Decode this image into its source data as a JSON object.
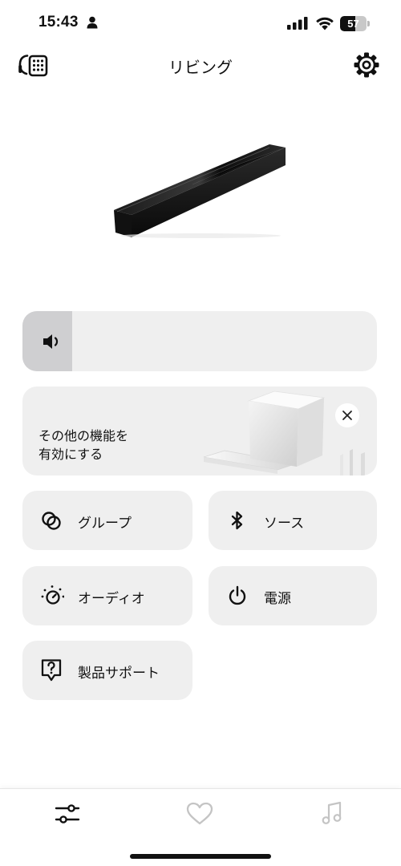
{
  "status_bar": {
    "time": "15:43",
    "battery_percent": "57",
    "battery_level": 0.57,
    "icons": [
      "person-icon",
      "cellular-signal-icon",
      "wifi-icon",
      "battery-icon"
    ]
  },
  "header": {
    "title": "リビング",
    "left_icon": "remote-control-icon",
    "right_icon": "gear-icon"
  },
  "volume": {
    "icon": "speaker-volume-icon",
    "level": 0.14
  },
  "promo": {
    "line1": "その他の機能を",
    "line2": "有効にする",
    "close_icon": "close-icon"
  },
  "tiles": {
    "group": {
      "label": "グループ",
      "icon": "group-circles-icon"
    },
    "source": {
      "label": "ソース",
      "icon": "bluetooth-icon"
    },
    "audio": {
      "label": "オーディオ",
      "icon": "audio-adjust-icon"
    },
    "power": {
      "label": "電源",
      "icon": "power-icon"
    },
    "support": {
      "label": "製品サポート",
      "icon": "help-question-icon"
    }
  },
  "bottom_nav": {
    "items": [
      {
        "name": "controls",
        "icon": "sliders-icon",
        "active": true
      },
      {
        "name": "favorites",
        "icon": "heart-icon",
        "active": false
      },
      {
        "name": "music",
        "icon": "music-note-icon",
        "active": false
      }
    ]
  },
  "colors": {
    "tile_background": "#efefef",
    "volume_fill": "#cfcfd1",
    "active_icon": "#111111",
    "inactive_icon": "#c4c4c4"
  }
}
